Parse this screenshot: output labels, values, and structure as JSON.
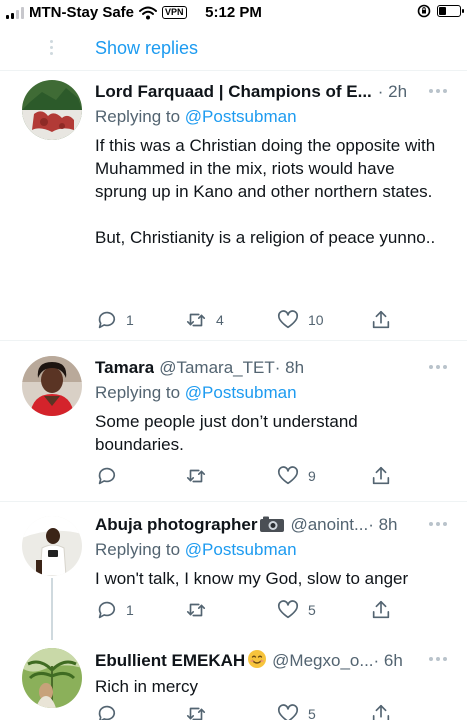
{
  "status_bar": {
    "carrier": "MTN-Stay Safe",
    "vpn": "VPN",
    "time": "5:12 PM",
    "battery_level": 0.35
  },
  "thread": {
    "show_replies": "Show replies"
  },
  "tweets": [
    {
      "name": "Lord Farquaad | Champions of E...",
      "handle": "",
      "time": "· 2h",
      "replying_prefix": "Replying to ",
      "replying_to": "@Postsubman",
      "paragraphs": [
        "If this was a Christian doing the opposite with Muhammed in the mix, riots would have sprung up in Kano and other northern states.",
        "But, Christianity is a religion of peace yunno.."
      ],
      "replies": "1",
      "retweets": "4",
      "likes": "10"
    },
    {
      "name": "Tamara",
      "handle": "@Tamara_TET",
      "time": " · 8h",
      "replying_prefix": "Replying to ",
      "replying_to": "@Postsubman",
      "paragraphs": [
        "Some people just don’t understand boundaries."
      ],
      "replies": "",
      "retweets": "",
      "likes": "9"
    },
    {
      "name": "Abuja photographer",
      "handle": "@anoint...",
      "time": " · 8h",
      "replying_prefix": "Replying to ",
      "replying_to": "@Postsubman",
      "paragraphs": [
        "I won't talk, I know my God, slow to anger"
      ],
      "replies": "1",
      "retweets": "",
      "likes": "5"
    },
    {
      "name": "Ebullient EMEKAH",
      "handle": "@Megxo_o...",
      "time": " · 6h",
      "paragraphs": [
        "Rich in mercy"
      ],
      "replies": "",
      "retweets": "",
      "likes": "5"
    }
  ],
  "colors": {
    "accent": "#1d9bf0",
    "secondary_text": "#536471"
  }
}
